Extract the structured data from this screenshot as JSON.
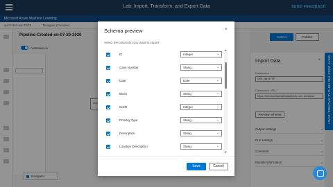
{
  "lab_bar": {
    "title": "Lab: Import, Transform, and Export Data",
    "feedback_label": "SEND FEEDBACK"
  },
  "aml": {
    "title": "Microsoft Azure Machine Learning"
  },
  "breadcrumbs": [
    "quickstart-ws-03/19",
    "Designer (Preview)"
  ],
  "designer": {
    "pipeline_title": "Pipeline-Created-on-07-20-2020",
    "autosave_label": "Autosave on",
    "node_label": "Import",
    "navigator_label": "Navigator",
    "submit_label": "Submit",
    "publish_label": "Publish"
  },
  "right_panel": {
    "title": "Import Data",
    "close_icon": "×",
    "datasource_label": "Datasource *",
    "datasource_value": "URL via HTTP",
    "url_label": "Datasource URL *",
    "url_value": "https://introtomlsampledata.blob.core.windows",
    "preview_label": "Preview schema",
    "sections": [
      "Output settings",
      "Run settings",
      "Comment",
      "Module information"
    ]
  },
  "side_tab": {
    "label": "WHAT DOES THE VIRTUAL MACHINE HAVE?"
  },
  "modal": {
    "title": "Schema preview",
    "close_icon": "×",
    "instruction": "Select the column(s) you want to import",
    "columns": [
      {
        "name": "ID",
        "type": "Integer",
        "checked": true
      },
      {
        "name": "Case Number",
        "type": "String",
        "checked": true
      },
      {
        "name": "Date",
        "type": "Date",
        "checked": true
      },
      {
        "name": "Block",
        "type": "String",
        "checked": true
      },
      {
        "name": "IUCR",
        "type": "Integer",
        "checked": true
      },
      {
        "name": "Primary Type",
        "type": "String",
        "checked": true
      },
      {
        "name": "Description",
        "type": "String",
        "checked": true
      },
      {
        "name": "Location Description",
        "type": "String",
        "checked": true
      }
    ],
    "save_label": "Save",
    "cancel_label": "Cancel"
  },
  "colors": {
    "accent": "#0078d4",
    "lab_bar": "#1b3a5c",
    "aml_bar": "#0f4c8a",
    "overlay": "rgba(0,0,0,0.42)"
  },
  "icons": {
    "menu": "hamburger-icon",
    "close": "close-icon",
    "chevron": "chevron-down-icon",
    "help": "chat-help-icon"
  }
}
